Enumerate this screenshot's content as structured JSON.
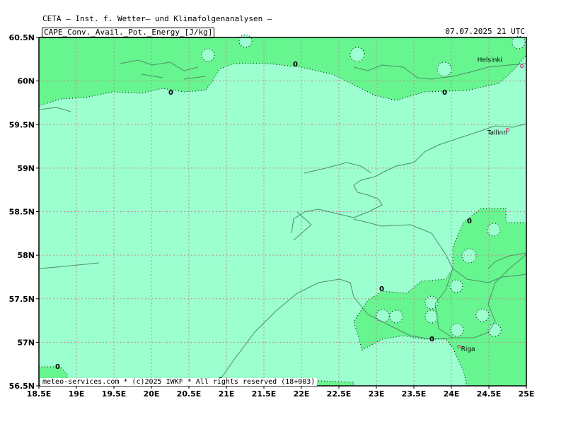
{
  "header": {
    "org": "CETA – Inst. f. Wetter– und Klimafolgenanalysen –",
    "parameter": "CAPE_Conv._Avail._Pot._Energy_[J/kg]",
    "valid_time": "07.07.2025 21 UTC"
  },
  "axes": {
    "lat_labels": [
      "60.5N",
      "60N",
      "59.5N",
      "59N",
      "58.5N",
      "58N",
      "57.5N",
      "57N",
      "56.5N"
    ],
    "lon_labels": [
      "18.5E",
      "19E",
      "19.5E",
      "20E",
      "20.5E",
      "21E",
      "21.5E",
      "22E",
      "22.5E",
      "23E",
      "23.5E",
      "24E",
      "24.5E",
      "25E"
    ],
    "lat_range": [
      56.5,
      60.5
    ],
    "lon_range": [
      18.5,
      25.0
    ]
  },
  "cities": [
    {
      "name": "Helsinki",
      "lon": 24.94,
      "lat": 60.17
    },
    {
      "name": "Tallinn",
      "lon": 24.75,
      "lat": 59.44
    },
    {
      "name": "Riga",
      "lon": 24.1,
      "lat": 56.95
    }
  ],
  "contour_labels": [
    "0",
    "0",
    "0",
    "0",
    "0",
    "0",
    "0",
    "0"
  ],
  "footer": {
    "credit": "meteo-services.com * (c)2025 IWKF * All rights reserved (18+003)"
  },
  "colors": {
    "cape_zero": "#9cffcf",
    "cape_low": "#66f58f",
    "coast": "#4f8f6a",
    "grid": "#c88a8a",
    "city_marker": "#e0156e"
  }
}
